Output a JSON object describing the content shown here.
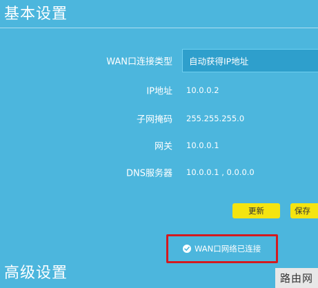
{
  "sections": {
    "basic_title": "基本设置",
    "advanced_title": "高级设置"
  },
  "wan": {
    "type_label": "WAN口连接类型",
    "type_value": "自动获得IP地址",
    "ip_label": "IP地址",
    "ip_value": "10.0.0.2",
    "mask_label": "子网掩码",
    "mask_value": "255.255.255.0",
    "gateway_label": "网关",
    "gateway_value": "10.0.0.1",
    "dns_label": "DNS服务器",
    "dns_value": "10.0.0.1 , 0.0.0.0"
  },
  "buttons": {
    "update": "更新",
    "save": "保存"
  },
  "status": {
    "text": "WAN口网络已连接",
    "icon": "check-circle-icon"
  },
  "watermark": "路由网",
  "colors": {
    "background": "#4cb6dd",
    "button": "#f5e410",
    "highlight_border": "#d31a1f"
  }
}
